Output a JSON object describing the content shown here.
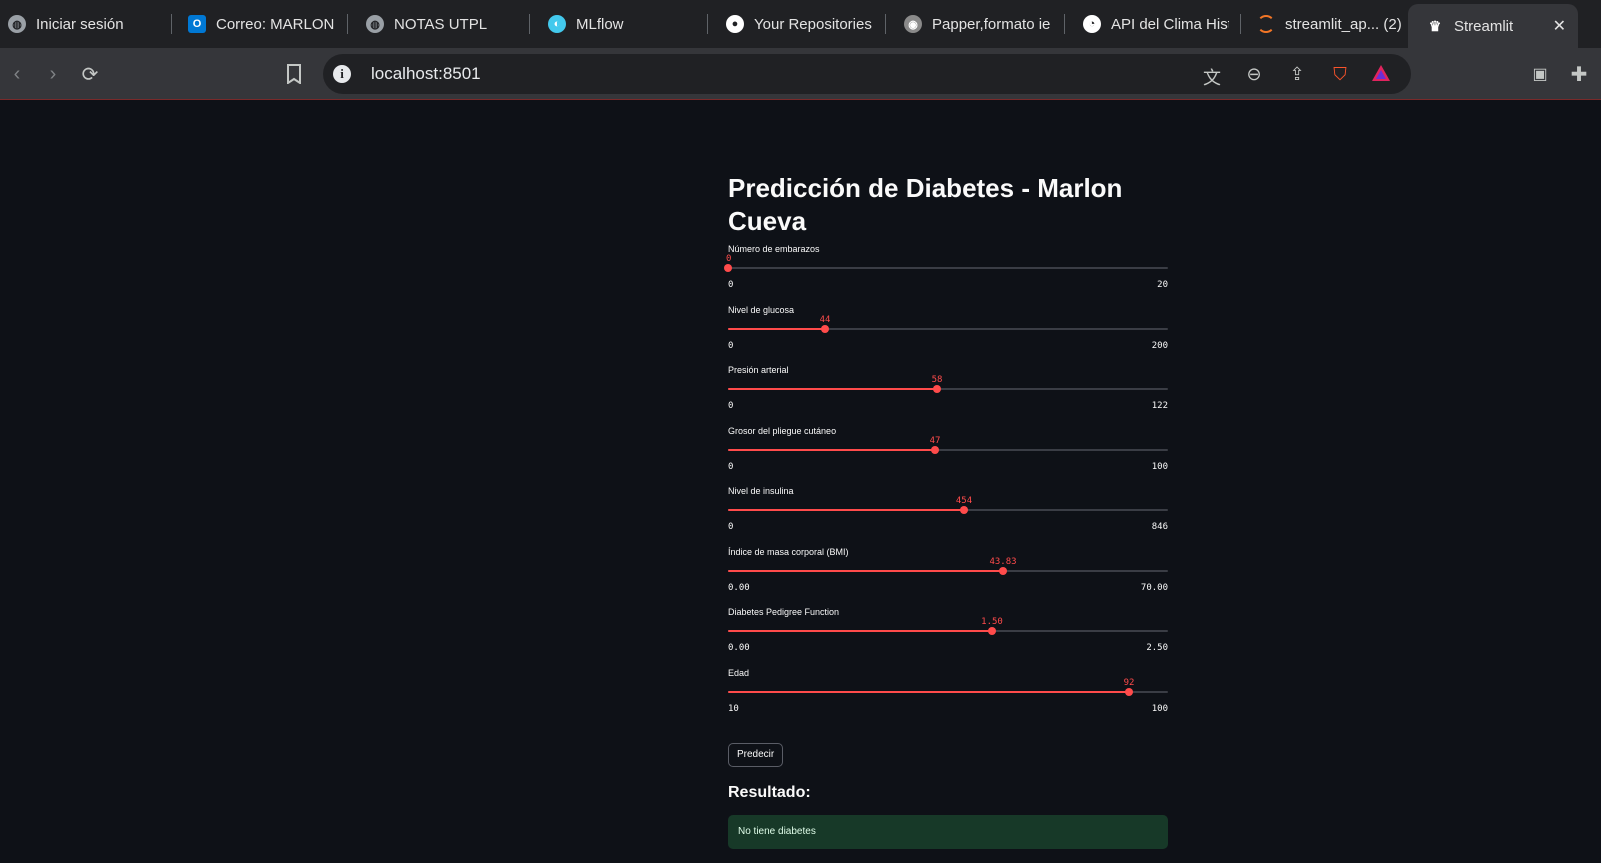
{
  "browser": {
    "tabs": [
      {
        "title": "Iniciar sesión",
        "icon": "globe-icon",
        "icon_color": "#9aa0a6"
      },
      {
        "title": "Correo: MARLON",
        "icon": "outlook-icon",
        "icon_color": "#0078d4"
      },
      {
        "title": "NOTAS UTPL",
        "icon": "globe-icon",
        "icon_color": "#9aa0a6"
      },
      {
        "title": "MLflow",
        "icon": "mlflow-icon",
        "icon_color": "#43c9ed"
      },
      {
        "title": "Your Repositories",
        "icon": "github-icon",
        "icon_color": "#ffffff"
      },
      {
        "title": "Papper,formato ie",
        "icon": "overleaf-icon",
        "icon_color": "#8a8a8a"
      },
      {
        "title": "API del Clima Hist",
        "icon": "api-icon",
        "icon_color": "#ffffff"
      },
      {
        "title": "streamlit_ap... (2)",
        "icon": "jupyter-icon",
        "icon_color": "#f37626"
      },
      {
        "title": "Streamlit",
        "icon": "streamlit-icon",
        "icon_color": "#ffffff",
        "active": true
      }
    ],
    "url": "localhost:8501"
  },
  "app": {
    "title": "Predicción de Diabetes - Marlon Cueva",
    "sliders": [
      {
        "label": "Número de embarazos",
        "value": "0",
        "min": "0",
        "max": "20",
        "fraction": 0.0
      },
      {
        "label": "Nivel de glucosa",
        "value": "44",
        "min": "0",
        "max": "200",
        "fraction": 0.22
      },
      {
        "label": "Presión arterial",
        "value": "58",
        "min": "0",
        "max": "122",
        "fraction": 0.4754
      },
      {
        "label": "Grosor del pliegue cutáneo",
        "value": "47",
        "min": "0",
        "max": "100",
        "fraction": 0.47
      },
      {
        "label": "Nivel de insulina",
        "value": "454",
        "min": "0",
        "max": "846",
        "fraction": 0.5366
      },
      {
        "label": "Índice de masa corporal (BMI)",
        "value": "43.83",
        "min": "0.00",
        "max": "70.00",
        "fraction": 0.6261
      },
      {
        "label": "Diabetes Pedigree Function",
        "value": "1.50",
        "min": "0.00",
        "max": "2.50",
        "fraction": 0.6
      },
      {
        "label": "Edad",
        "value": "92",
        "min": "10",
        "max": "100",
        "fraction": 0.9111
      }
    ],
    "predict_label": "Predecir",
    "result_heading": "Resultado:",
    "result_text": "No tiene diabetes",
    "accent_color": "#ff4b4b",
    "success_bg": "#173928"
  }
}
